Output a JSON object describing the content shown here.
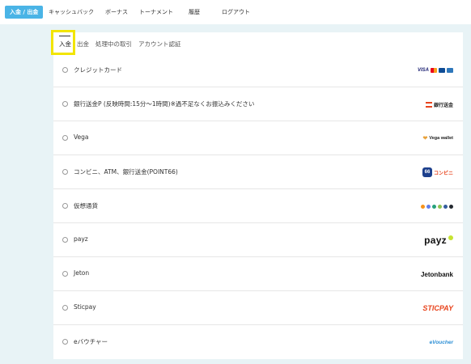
{
  "nav": {
    "items": [
      {
        "label": "入金 / 出金",
        "active": true
      },
      {
        "label": "キャッシュバック",
        "active": false
      },
      {
        "label": "ボーナス",
        "active": false
      },
      {
        "label": "トーナメント",
        "active": false
      },
      {
        "label": "履歴",
        "active": false
      },
      {
        "label": "ログアウト",
        "active": false
      }
    ]
  },
  "tabs": [
    {
      "label": "入金",
      "active": true
    },
    {
      "label": "出金",
      "active": false
    },
    {
      "label": "処理中の取引",
      "active": false
    },
    {
      "label": "アカウント認証",
      "active": false
    }
  ],
  "methods": [
    {
      "label": "クレジットカード",
      "logo": "card-brands-logo"
    },
    {
      "label": "銀行送金P (反映時間:15分〜1時間)※過不足なくお振込みください",
      "logo": "bank-transfer-logo",
      "logo_text": "銀行送金"
    },
    {
      "label": "Vega",
      "logo": "vega-wallet-logo",
      "logo_text": "Vega wallet"
    },
    {
      "label": "コンビニ、ATM、銀行送金(POINT66)",
      "logo": "point66-logo",
      "logo_text": "コンビニ",
      "logo_num": "66"
    },
    {
      "label": "仮想通貨",
      "logo": "crypto-coins-logo"
    },
    {
      "label": "payz",
      "logo": "payz-logo",
      "logo_text": "payz"
    },
    {
      "label": "Jeton",
      "logo": "jeton-logo",
      "logo_text": "Jetonbank"
    },
    {
      "label": "Sticpay",
      "logo": "sticpay-logo",
      "logo_text": "STICPAY"
    },
    {
      "label": "eバウチャー",
      "logo": "evoucher-logo",
      "logo_text": "eVoucher"
    }
  ],
  "colors": {
    "accent": "#4ab4e6",
    "highlight": "#f2e500",
    "sticpay": "#e8441d",
    "payz_dot": "#c6e332"
  }
}
